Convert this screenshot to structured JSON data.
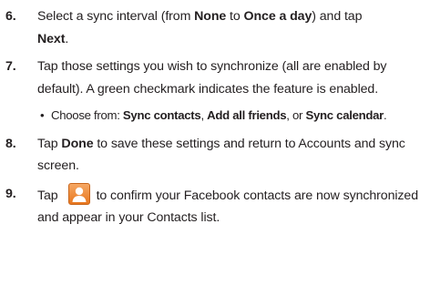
{
  "steps": [
    {
      "number": "6.",
      "p1": "Select a sync interval (from ",
      "b1": "None",
      "p2": " to ",
      "b2": "Once a day",
      "p3": ") and tap ",
      "b3": "Next",
      "p4": "."
    },
    {
      "number": "7.",
      "text": "Tap those settings you wish to synchronize (all are enabled by default). A green checkmark indicates the feature is enabled."
    },
    {
      "number": "8.",
      "p1": "Tap ",
      "b1": "Done",
      "p2": " to save these settings and return to Accounts and sync screen."
    },
    {
      "number": "9.",
      "p1": "Tap",
      "icon": "contacts-app-icon",
      "p2": "to confirm your Facebook contacts are now synchronized and appear in your Contacts list."
    }
  ],
  "bullet": {
    "symbol": "•",
    "p1": "Choose from: ",
    "b1": "Sync contacts",
    "p2": ", ",
    "b2": "Add all friends",
    "p3": ", or ",
    "b3": "Sync calendar",
    "p4": "."
  },
  "colors": {
    "text": "#231f20",
    "icon_orange": "#e8771e"
  }
}
